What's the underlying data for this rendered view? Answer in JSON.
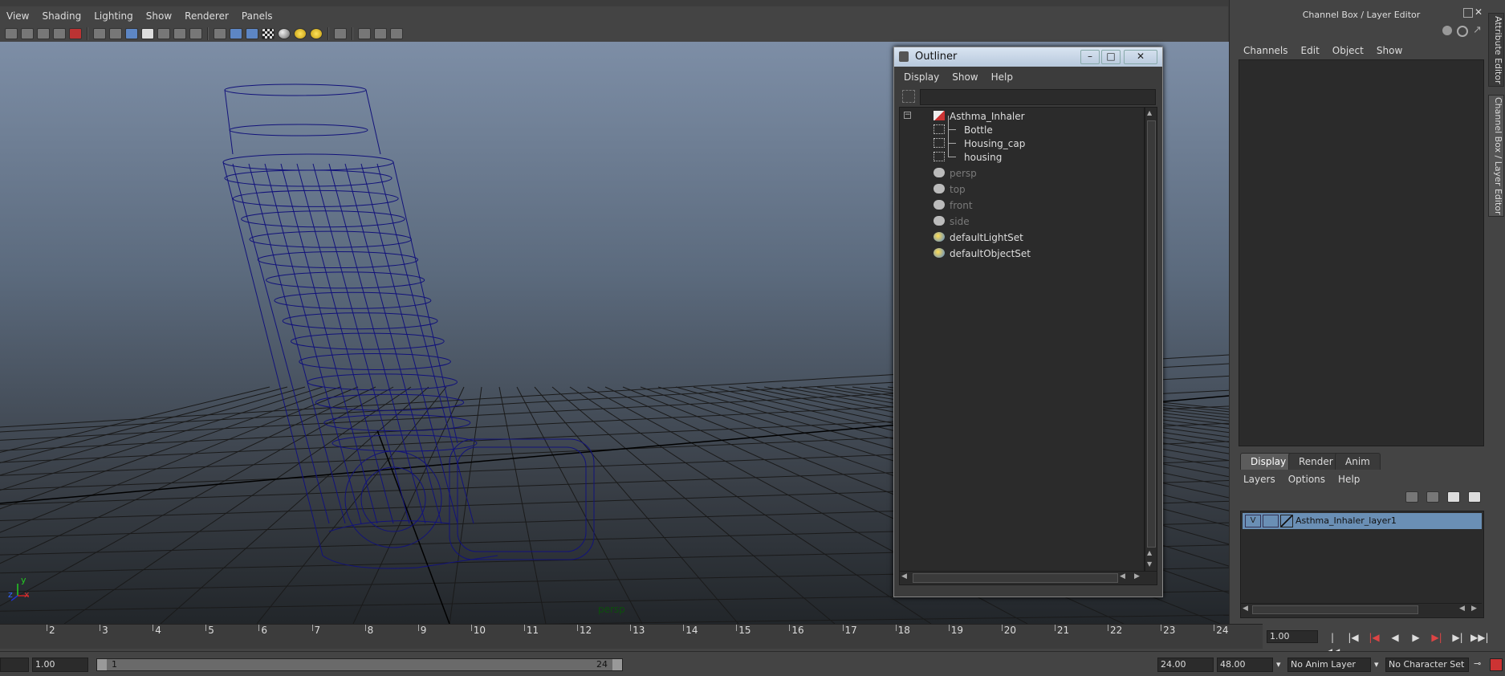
{
  "menubar": [
    "View",
    "Shading",
    "Lighting",
    "Show",
    "Renderer",
    "Panels"
  ],
  "viewport": {
    "camera_label": "persp",
    "axis_labels": {
      "y": "y",
      "z": "z",
      "x": "x"
    }
  },
  "outliner": {
    "title": "Outliner",
    "menu": [
      "Display",
      "Show",
      "Help"
    ],
    "items": [
      {
        "label": "Asthma_Inhaler",
        "icon": "group-icon",
        "dim": false
      },
      {
        "label": "Bottle",
        "icon": "mesh-icon",
        "dim": false
      },
      {
        "label": "Housing_cap",
        "icon": "mesh-icon",
        "dim": false
      },
      {
        "label": "housing",
        "icon": "mesh-icon",
        "dim": false
      },
      {
        "label": "persp",
        "icon": "camera-icon",
        "dim": true
      },
      {
        "label": "top",
        "icon": "camera-icon",
        "dim": true
      },
      {
        "label": "front",
        "icon": "camera-icon",
        "dim": true
      },
      {
        "label": "side",
        "icon": "camera-icon",
        "dim": true
      },
      {
        "label": "defaultLightSet",
        "icon": "set-icon",
        "dim": false
      },
      {
        "label": "defaultObjectSet",
        "icon": "set-icon",
        "dim": false
      }
    ]
  },
  "right_panel": {
    "title": "Channel Box / Layer Editor",
    "menu": [
      "Channels",
      "Edit",
      "Object",
      "Show"
    ],
    "tabs": [
      "Display",
      "Render",
      "Anim"
    ],
    "active_tab": "Display",
    "layer_menu": [
      "Layers",
      "Options",
      "Help"
    ],
    "layer": {
      "visible_flag": "V",
      "name": "Asthma_Inhaler_layer1"
    },
    "side_tabs": [
      "Attribute Editor",
      "Channel Box / Layer Editor"
    ]
  },
  "timeline": {
    "ticks": [
      "2",
      "3",
      "4",
      "5",
      "6",
      "7",
      "8",
      "9",
      "10",
      "11",
      "12",
      "13",
      "14",
      "15",
      "16",
      "17",
      "18",
      "19",
      "20",
      "21",
      "22",
      "23",
      "24"
    ],
    "current_time": "1.00"
  },
  "range": {
    "start_time": "1.00",
    "range_start": "1",
    "range_end": "24",
    "end_time": "24.00",
    "total_end": "48.00",
    "anim_layer": "No Anim Layer",
    "character_set": "No Character Set"
  }
}
